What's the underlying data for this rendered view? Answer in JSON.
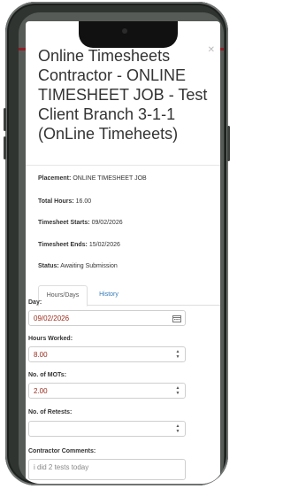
{
  "modal": {
    "title": "Online Timesheets Contractor - ONLINE TIMESHEET JOB - Test Client Branch 3-1-1 (OnLine Timeheets)",
    "close_icon": "close-icon"
  },
  "details": {
    "placement_label": "Placement:",
    "placement_value": "ONLINE TIMESHEET JOB",
    "total_hours_label": "Total Hours:",
    "total_hours_value": "16.00",
    "starts_label": "Timesheet Starts:",
    "starts_value": "09/02/2026",
    "ends_label": "Timesheet Ends:",
    "ends_value": "15/02/2026",
    "status_label": "Status:",
    "status_value": "Awaiting Submission"
  },
  "tabs": [
    {
      "label": "Hours/Days",
      "active": true
    },
    {
      "label": "History",
      "active": false
    }
  ],
  "form": {
    "day_label": "Day:",
    "day_value": "09/02/2026",
    "hours_label": "Hours Worked:",
    "hours_value": "8.00",
    "mots_label": "No. of MOTs:",
    "mots_value": "2.00",
    "retests_label": "No. of Retests:",
    "retests_value": "",
    "comments_label": "Contractor Comments:",
    "comments_value": "i did 2 tests today"
  },
  "colors": {
    "brand_red": "#8c1f24",
    "value_text": "#9b2a1a",
    "link": "#337ab7"
  }
}
